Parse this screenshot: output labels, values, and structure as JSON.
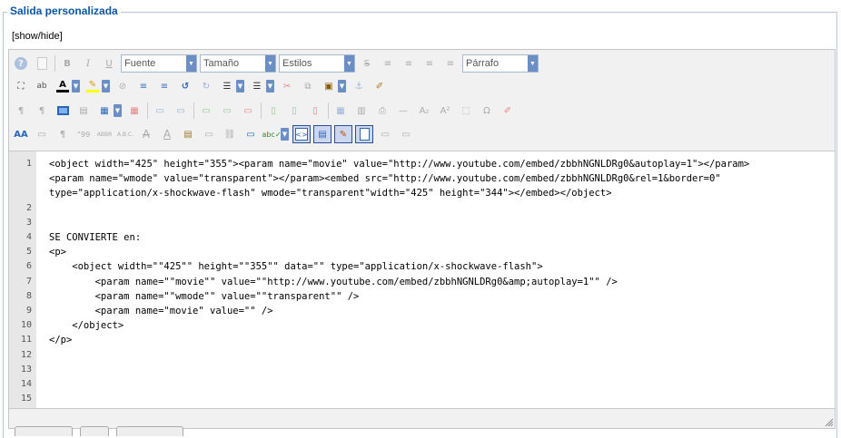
{
  "fieldset": {
    "legend": "Salida personalizada",
    "toggle_label": "[show/hide]"
  },
  "toolbar": {
    "row1": {
      "font_select": "Fuente",
      "size_select": "Tamaño",
      "styles_select": "Estilos",
      "format_select": "Párrafo"
    },
    "row3_buttons": [
      "ltr",
      "rtl",
      "preview",
      "template",
      "visualchars",
      "removeformat",
      "table",
      "delete-table",
      "insert-row",
      "delete-row",
      "split-cells",
      "merge-cells",
      "sub",
      "sup",
      "charmap",
      "cleanup"
    ],
    "row4_active_buttons": [
      "source-code",
      "fullscreen",
      "edit-css",
      "restore"
    ]
  },
  "code": {
    "lines": [
      {
        "n": "1",
        "text": "<object width=\"425\" height=\"355\"><param name=\"movie\" value=\"http://www.youtube.com/embed/zbbhNGNLDRg0&autoplay=1\"></param>"
      },
      {
        "n": "",
        "text": "<param name=\"wmode\" value=\"transparent\"></param><embed src=\"http://www.youtube.com/embed/zbbhNGNLDRg0&rel=1&border=0\""
      },
      {
        "n": "",
        "text": "type=\"application/x-shockwave-flash\" wmode=\"transparent\"width=\"425\" height=\"344\"></embed></object>"
      },
      {
        "n": "2",
        "text": ""
      },
      {
        "n": "3",
        "text": ""
      },
      {
        "n": "4",
        "text": "SE CONVIERTE en:"
      },
      {
        "n": "5",
        "text": "<p>"
      },
      {
        "n": "6",
        "text": "    <object width=\"\"425\"\" height=\"\"355\"\" data=\"\" type=\"application/x-shockwave-flash\">"
      },
      {
        "n": "7",
        "text": "        <param name=\"\"movie\"\" value=\"\"http://www.youtube.com/embed/zbbhNGNLDRg0&amp;autoplay=1\"\" />"
      },
      {
        "n": "8",
        "text": "        <param name=\"\"wmode\"\" value=\"\"transparent\"\" />"
      },
      {
        "n": "9",
        "text": "        <param name=\"movie\" value=\"\" />"
      },
      {
        "n": "10",
        "text": "    </object>"
      },
      {
        "n": "11",
        "text": "</p>"
      },
      {
        "n": "12",
        "text": ""
      },
      {
        "n": "13",
        "text": ""
      },
      {
        "n": "14",
        "text": ""
      },
      {
        "n": "15",
        "text": ""
      },
      {
        "n": "16",
        "text": ""
      }
    ]
  }
}
